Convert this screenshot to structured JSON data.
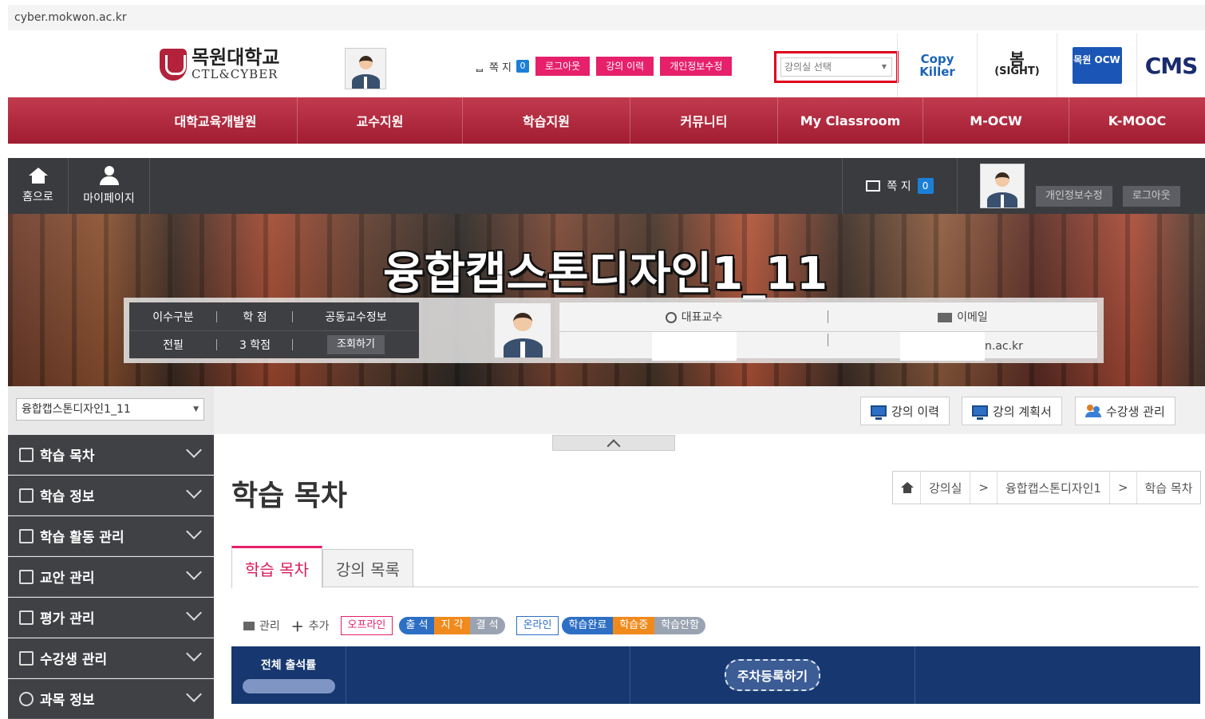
{
  "browser": {
    "url": "cyber.mokwon.ac.kr"
  },
  "site": {
    "logo_main": "목원대학교",
    "logo_sub": "CTL&CYBER",
    "top_msg_label": "쪽 지",
    "top_msg_count": "0",
    "top_buttons": [
      "로그아웃",
      "강의 이력",
      "개인정보수정"
    ],
    "course_select_placeholder": "강의실 선택",
    "quick_links": {
      "copykiller": "Copy Killer",
      "sight_main": "봄",
      "sight_sub": "(SIGHT)",
      "ocw": "목원 OCW",
      "cms": "CMS"
    }
  },
  "main_nav": [
    "대학교육개발원",
    "교수지원",
    "학습지원",
    "커뮤니티",
    "My Classroom",
    "M-OCW",
    "K-MOOC"
  ],
  "classroom": {
    "home_label": "홈으로",
    "mypage_label": "마이페이지",
    "msg_label": "쪽 지",
    "msg_count": "0",
    "edit_profile_label": "개인정보수정",
    "logout_label": "로그아웃",
    "course_title": "융합캡스톤디자인1_11",
    "info": {
      "headers": [
        "이수구분",
        "학 점",
        "공동교수정보"
      ],
      "values": [
        "전필",
        "3 학점"
      ],
      "view_button": "조회하기",
      "professor_label": "대표교수",
      "email_label": "이메일",
      "email_value_visible": "n.ac.kr"
    }
  },
  "sidebar": {
    "course_select_value": "융합캡스톤디자인1_11",
    "items": [
      "학습 목차",
      "학습 정보",
      "학습 활동 관리",
      "교안 관리",
      "평가 관리",
      "수강생 관리",
      "과목 정보"
    ]
  },
  "content": {
    "top_buttons": [
      "강의 이력",
      "강의 계획서",
      "수강생 관리"
    ],
    "page_title": "학습 목차",
    "breadcrumb": [
      "강의실",
      "융합캡스톤디자인1",
      "학습 목차"
    ],
    "tabs": [
      "학습 목차",
      "강의 목록"
    ],
    "toolbar": {
      "manage": "관리",
      "add": "추가",
      "offline": "오프라인",
      "offline_states": [
        "출 석",
        "지 각",
        "결 석"
      ],
      "online": "온라인",
      "online_states": [
        "학습완료",
        "학습중",
        "학습안함"
      ]
    },
    "grid": {
      "attendance_label": "전체 출석률",
      "register_week_button": "주차등록하기"
    }
  },
  "colors": {
    "brand_red": "#b3213a",
    "accent_pink": "#e6206b",
    "nav_dark": "#404145",
    "grid_navy": "#16376f",
    "highlight_red": "#e0001b"
  }
}
